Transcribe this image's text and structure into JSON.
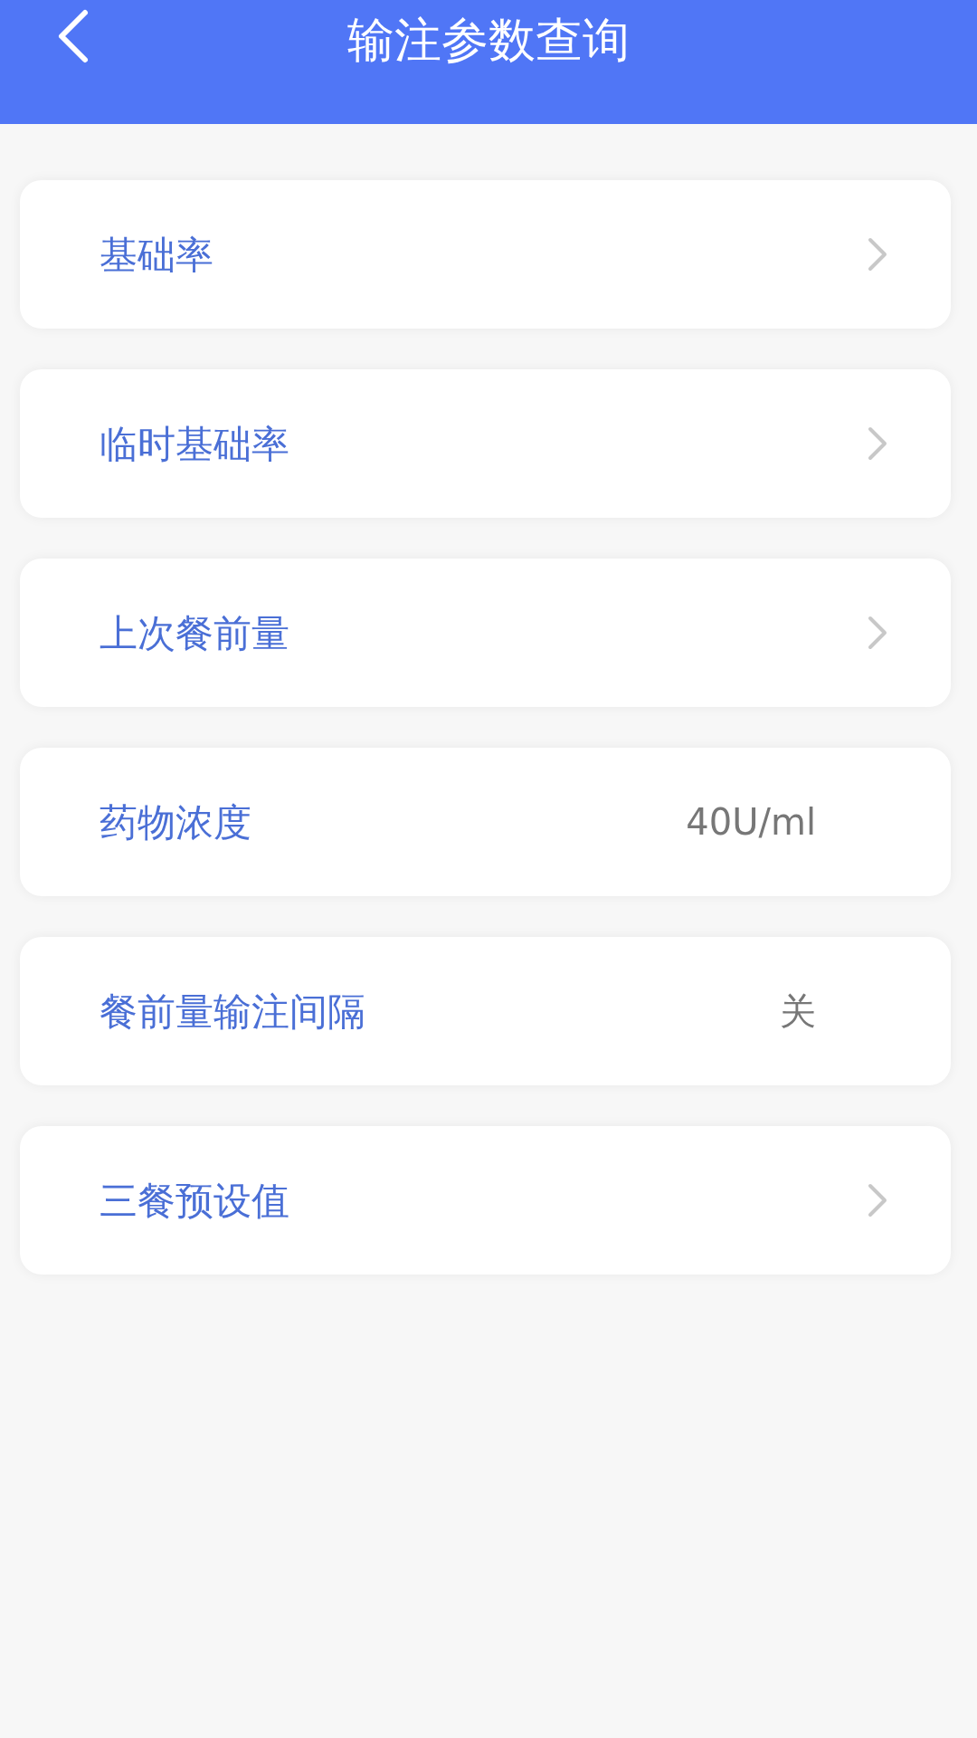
{
  "header": {
    "title": "输注参数查询"
  },
  "items": [
    {
      "label": "基础率",
      "kind": "link"
    },
    {
      "label": "临时基础率",
      "kind": "link"
    },
    {
      "label": "上次餐前量",
      "kind": "link"
    },
    {
      "label": "药物浓度",
      "kind": "value",
      "value": "40U/ml"
    },
    {
      "label": "餐前量输注间隔",
      "kind": "value",
      "value": "关"
    },
    {
      "label": "三餐预设值",
      "kind": "link"
    }
  ]
}
